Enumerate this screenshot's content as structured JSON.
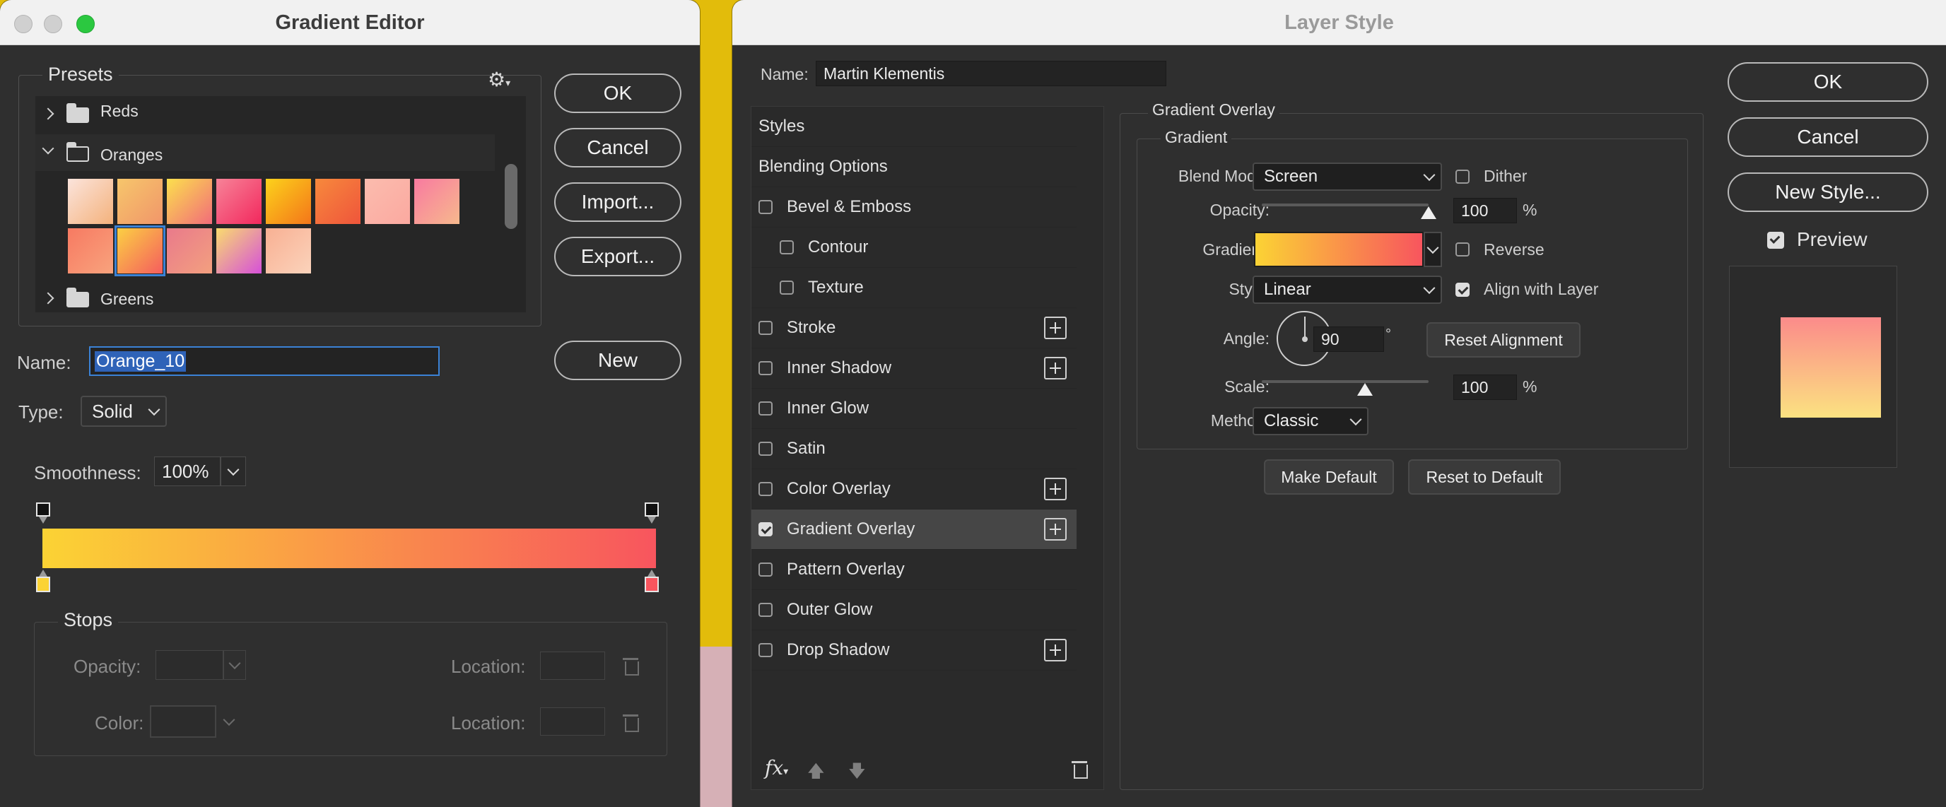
{
  "gradient_editor": {
    "title": "Gradient Editor",
    "presets_label": "Presets",
    "folders": [
      {
        "label": "Reds",
        "expanded": false
      },
      {
        "label": "Oranges",
        "expanded": true
      },
      {
        "label": "Greens",
        "expanded": false
      }
    ],
    "swatches_row1": [
      [
        "#fbe4dc",
        "#f4b27c"
      ],
      [
        "#f6c66b",
        "#f1966a"
      ],
      [
        "#fbe04d",
        "#f26c7a"
      ],
      [
        "#f78398",
        "#f2285d"
      ],
      [
        "#fcd21b",
        "#f4761a"
      ],
      [
        "#f7893c",
        "#ef553b"
      ],
      [
        "#fbbcae",
        "#fba9a0"
      ],
      [
        "#f87aa0",
        "#f7b98d"
      ]
    ],
    "swatches_row2": [
      [
        "#f77a62",
        "#f8a37d"
      ],
      [
        "#fbd043",
        "#f55d5e"
      ],
      [
        "#e97a8b",
        "#f3a07f"
      ],
      [
        "#f9dc6e",
        "#d650d9"
      ],
      [
        "#f8b093",
        "#fbd3bb"
      ]
    ],
    "selected_swatch_row2": 1,
    "buttons": {
      "ok": "OK",
      "cancel": "Cancel",
      "import": "Import...",
      "export": "Export...",
      "new": "New"
    },
    "name_label": "Name:",
    "name_value": "Orange_10",
    "type_label": "Type:",
    "type_value": "Solid",
    "smoothness_label": "Smoothness:",
    "smoothness_value": "100%",
    "gradient_colors": {
      "start": "#fbd334",
      "end": "#f8555e"
    },
    "stops": {
      "title": "Stops",
      "opacity_label": "Opacity:",
      "color_label": "Color:",
      "location_label_1": "Location:",
      "location_label_2": "Location:"
    }
  },
  "layer_style": {
    "title": "Layer Style",
    "name_label": "Name:",
    "name_value": "Martin Klementis",
    "styles_list": [
      {
        "label": "Styles",
        "checkbox": false,
        "checked": false,
        "plus": false,
        "indent": 0,
        "selected": false
      },
      {
        "label": "Blending Options",
        "checkbox": false,
        "checked": false,
        "plus": false,
        "indent": 0,
        "selected": false
      },
      {
        "label": "Bevel & Emboss",
        "checkbox": true,
        "checked": false,
        "plus": false,
        "indent": 0,
        "selected": false
      },
      {
        "label": "Contour",
        "checkbox": true,
        "checked": false,
        "plus": false,
        "indent": 1,
        "selected": false
      },
      {
        "label": "Texture",
        "checkbox": true,
        "checked": false,
        "plus": false,
        "indent": 1,
        "selected": false
      },
      {
        "label": "Stroke",
        "checkbox": true,
        "checked": false,
        "plus": true,
        "indent": 0,
        "selected": false
      },
      {
        "label": "Inner Shadow",
        "checkbox": true,
        "checked": false,
        "plus": true,
        "indent": 0,
        "selected": false
      },
      {
        "label": "Inner Glow",
        "checkbox": true,
        "checked": false,
        "plus": false,
        "indent": 0,
        "selected": false
      },
      {
        "label": "Satin",
        "checkbox": true,
        "checked": false,
        "plus": false,
        "indent": 0,
        "selected": false
      },
      {
        "label": "Color Overlay",
        "checkbox": true,
        "checked": false,
        "plus": true,
        "indent": 0,
        "selected": false
      },
      {
        "label": "Gradient Overlay",
        "checkbox": true,
        "checked": true,
        "plus": true,
        "indent": 0,
        "selected": true
      },
      {
        "label": "Pattern Overlay",
        "checkbox": true,
        "checked": false,
        "plus": false,
        "indent": 0,
        "selected": false
      },
      {
        "label": "Outer Glow",
        "checkbox": true,
        "checked": false,
        "plus": false,
        "indent": 0,
        "selected": false
      },
      {
        "label": "Drop Shadow",
        "checkbox": true,
        "checked": false,
        "plus": true,
        "indent": 0,
        "selected": false
      }
    ],
    "footer_fx": "fx",
    "section_title": "Gradient Overlay",
    "group_title": "Gradient",
    "blend_mode_label": "Blend Mode:",
    "blend_mode_value": "Screen",
    "dither_label": "Dither",
    "opacity_label": "Opacity:",
    "opacity_value": "100",
    "percent": "%",
    "gradient_label": "Gradient:",
    "reverse_label": "Reverse",
    "style_label": "Style:",
    "style_value": "Linear",
    "align_label": "Align with Layer",
    "angle_label": "Angle:",
    "angle_value": "90",
    "degree": "°",
    "reset_alignment": "Reset Alignment",
    "scale_label": "Scale:",
    "scale_value": "100",
    "method_label": "Method:",
    "method_value": "Classic",
    "make_default": "Make Default",
    "reset_default": "Reset to Default",
    "buttons": {
      "ok": "OK",
      "cancel": "Cancel",
      "new_style": "New Style..."
    },
    "preview_label": "Preview",
    "opacity_fraction": 1.0,
    "scale_fraction": 0.62,
    "preview_colors": {
      "top": "#fb8b8a",
      "bottom": "#fbe281"
    }
  }
}
